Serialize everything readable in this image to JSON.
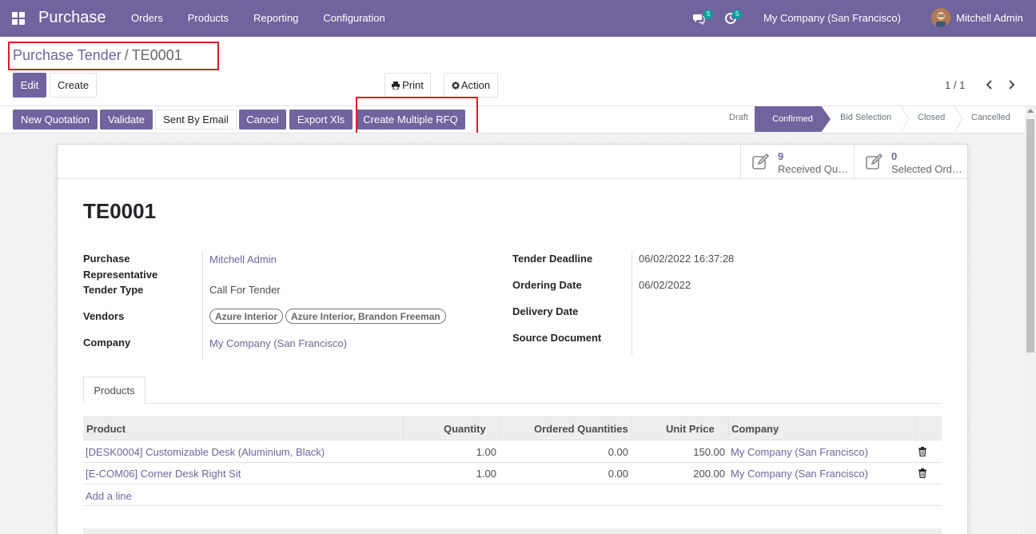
{
  "navbar": {
    "app_title": "Purchase",
    "menu": [
      "Orders",
      "Products",
      "Reporting",
      "Configuration"
    ],
    "messages_count": "5",
    "activities_count": "5",
    "company": "My Company (San Francisco)",
    "user": "Mitchell Admin",
    "color": "#71639e"
  },
  "breadcrumb": {
    "parent": "Purchase Tender",
    "separator": "/",
    "current": "TE0001"
  },
  "toolbar": {
    "edit": "Edit",
    "create": "Create",
    "print": "Print",
    "action": "Action",
    "pager": "1 / 1"
  },
  "actions": {
    "new_quotation": "New Quotation",
    "validate": "Validate",
    "sent_by_email": "Sent By Email",
    "cancel": "Cancel",
    "export_xls": "Export Xls",
    "create_multiple_rfq": "Create Multiple RFQ"
  },
  "status": {
    "stages": [
      "Draft",
      "Confirmed",
      "Bid Selection",
      "Closed",
      "Cancelled"
    ],
    "active": "Confirmed"
  },
  "smart_buttons": [
    {
      "count": "9",
      "label": "Received Quotations"
    },
    {
      "count": "0",
      "label": "Selected Orders"
    }
  ],
  "form": {
    "title": "TE0001",
    "purchase_rep_label_1": "Purchase",
    "purchase_rep_label_2": "Representative",
    "purchase_rep": "Mitchell Admin",
    "tender_type_label": "Tender Type",
    "tender_type": "Call For Tender",
    "vendors_label": "Vendors",
    "vendors": [
      "Azure Interior",
      "Azure Interior, Brandon Freeman"
    ],
    "company_label": "Company",
    "company": "My Company (San Francisco)",
    "deadline_label": "Tender Deadline",
    "deadline": "06/02/2022 16:37:28",
    "ordering_date_label": "Ordering Date",
    "ordering_date": "06/02/2022",
    "delivery_date_label": "Delivery Date",
    "source_document_label": "Source Document"
  },
  "tabs": {
    "products": "Products"
  },
  "table": {
    "columns": [
      "Product",
      "Quantity",
      "Ordered Quantities",
      "Unit Price",
      "Company"
    ],
    "rows": [
      {
        "product": "[DESK0004] Customizable Desk (Aluminium, Black)",
        "quantity": "1.00",
        "ordered": "0.00",
        "price": "150.00",
        "company": "My Company (San Francisco)"
      },
      {
        "product": "[E-COM06] Corner Desk Right Sit",
        "quantity": "1.00",
        "ordered": "0.00",
        "price": "200.00",
        "company": "My Company (San Francisco)"
      }
    ],
    "add_line": "Add a line"
  }
}
